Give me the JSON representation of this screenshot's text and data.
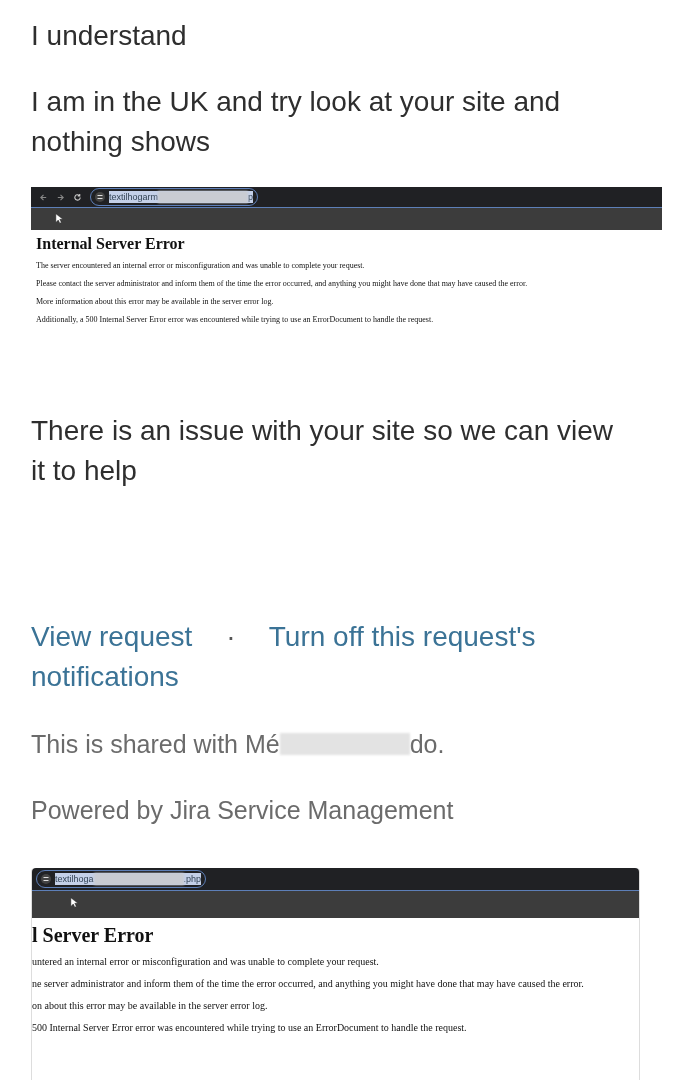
{
  "messages": [
    {
      "kind": "text",
      "text": "I understand"
    },
    {
      "kind": "text",
      "text": "I am in the UK and try look at your site and nothing shows"
    },
    {
      "kind": "screenshot",
      "nav": true,
      "url_prefix": "textilhogarm",
      "url_suffix": "p",
      "heading": "Internal Server Error",
      "lines": [
        "The server encountered an internal error or misconfiguration and was unable to complete your request.",
        "Please contact the server administrator and inform them of the time the error occurred, and anything you might have done that may have caused the error.",
        "More information about this error may be available in the server error log.",
        "Additionally, a 500 Internal Server Error error was encountered while trying to use an ErrorDocument to handle the request."
      ]
    },
    {
      "kind": "text",
      "text": "There is an issue with your site so we can view it to help"
    }
  ],
  "links": [
    {
      "kind": "link",
      "text": "View request"
    },
    {
      "kind": "separator",
      "text": "·"
    },
    {
      "kind": "link",
      "text": "Turn off this request's"
    },
    {
      "kind": "link",
      "text": "notifications"
    }
  ],
  "shared": {
    "prefix": "This is shared with Mé",
    "suffix": "do."
  },
  "powered_by": "Powered by Jira Service Management",
  "attachment": {
    "kind": "screenshot",
    "nav": false,
    "url_prefix": "textilhoga",
    "url_suffix": ".php",
    "heading": "l Server Error",
    "lines": [
      "untered an internal error or misconfiguration and was unable to complete your request.",
      "ne server administrator and inform them of the time the error occurred, and anything you might have done that may have caused the error.",
      "on about this error may be available in the server error log.",
      "500 Internal Server Error error was encountered while trying to use an ErrorDocument to handle the request."
    ]
  }
}
